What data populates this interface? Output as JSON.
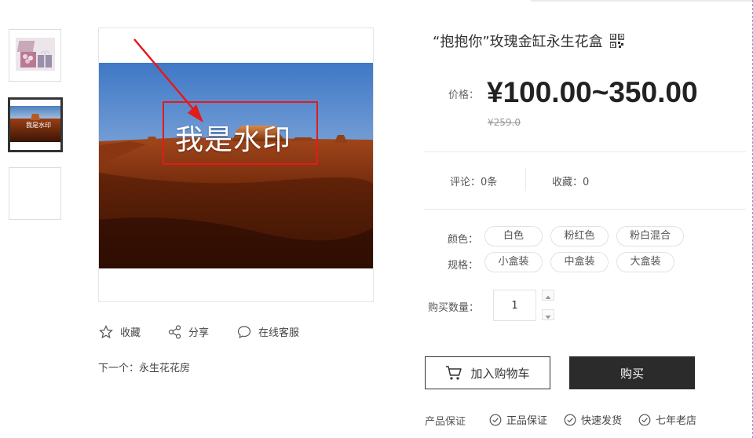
{
  "gallery": {
    "watermark_text": "我是水印",
    "thumb2_watermark": "我是水印"
  },
  "actions": {
    "favorite": "收藏",
    "share": "分享",
    "service": "在线客服"
  },
  "next_link": "下一个：永生花花房",
  "product": {
    "title": "“抱抱你”玫瑰金缸永生花盒",
    "price_label": "价格：",
    "price": "¥100.00~350.00",
    "old_price": "¥259.0",
    "comments": "评论：0条",
    "favorites": "收藏：0"
  },
  "options": {
    "color_label": "颜色：",
    "colors": [
      "白色",
      "粉红色",
      "粉白混合"
    ],
    "size_label": "规格：",
    "sizes": [
      "小盒装",
      "中盒装",
      "大盒装"
    ]
  },
  "quantity": {
    "label": "购买数量：",
    "value": "1"
  },
  "buttons": {
    "add_to_cart": "加入购物车",
    "buy": "购买"
  },
  "guarantee": {
    "label": "产品保证",
    "items": [
      "正品保证",
      "快速发货",
      "七年老店"
    ]
  },
  "colors": {
    "accent_red": "#e21b1b",
    "buy_button_bg": "#2b2b2b"
  }
}
